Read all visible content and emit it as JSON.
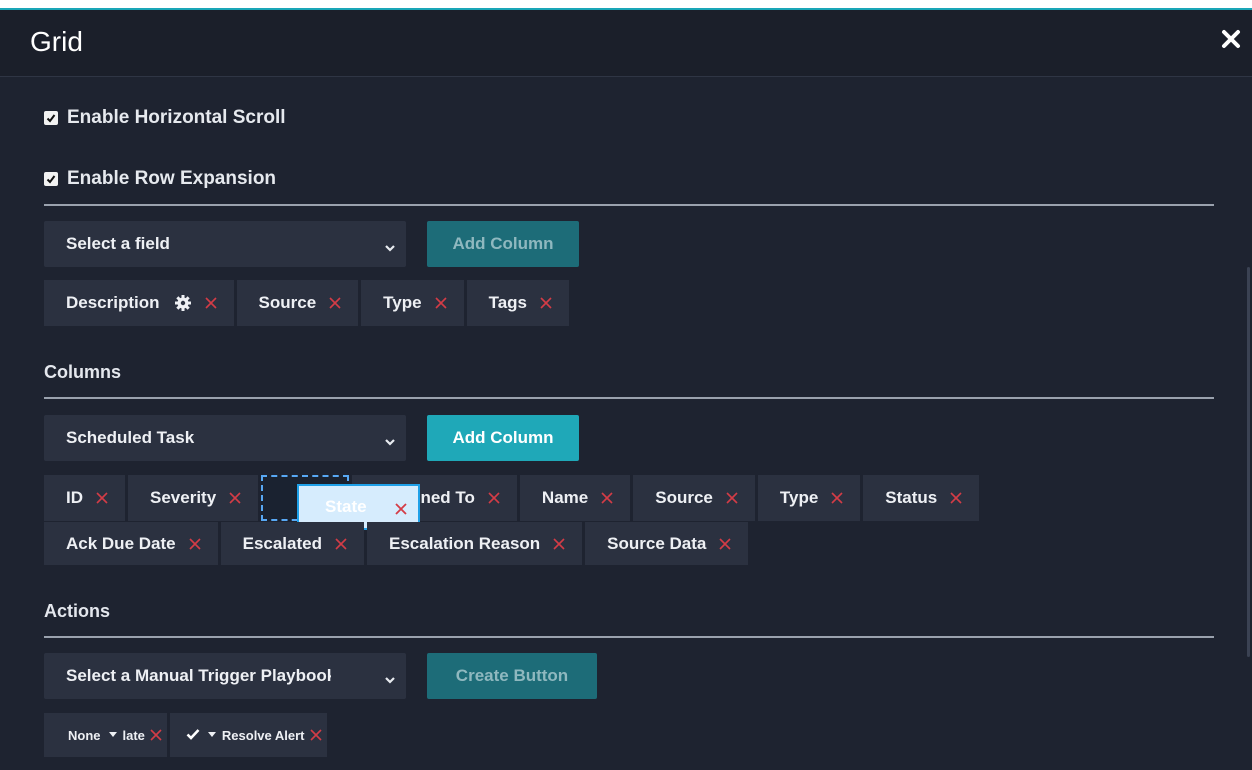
{
  "dialog": {
    "title": "Grid"
  },
  "options": {
    "horizontal_scroll": "Enable Horizontal Scroll",
    "row_expansion": "Enable Row Expansion"
  },
  "field_section": {
    "select_value": "Select a field",
    "add_button": "Add Column",
    "chips": [
      "Description",
      "Source",
      "Type",
      "Tags"
    ]
  },
  "columns_section": {
    "label": "Columns",
    "select_value": "Scheduled Task",
    "add_button": "Add Column",
    "row1": [
      "ID",
      "Severity",
      "Assigned To",
      "Name",
      "Source",
      "Type",
      "Status"
    ],
    "dragging_chip": "State",
    "row2": [
      "Ack Due Date",
      "Escalated",
      "Escalation Reason",
      "Source Data"
    ]
  },
  "actions_section": {
    "label": "Actions",
    "select_value": "Select a Manual Trigger Playbook",
    "create_button": "Create Button",
    "chips": [
      {
        "icon": "none",
        "label": "None",
        "text": "late"
      },
      {
        "icon": "check-icon",
        "label": "",
        "text": "Resolve Alert"
      }
    ]
  },
  "colors": {
    "background": "#1e2330",
    "chip": "#2b3140",
    "accent": "#1fa8b8",
    "remove_x": "#d43c46",
    "drag_highlight": "#1ea0e8"
  }
}
